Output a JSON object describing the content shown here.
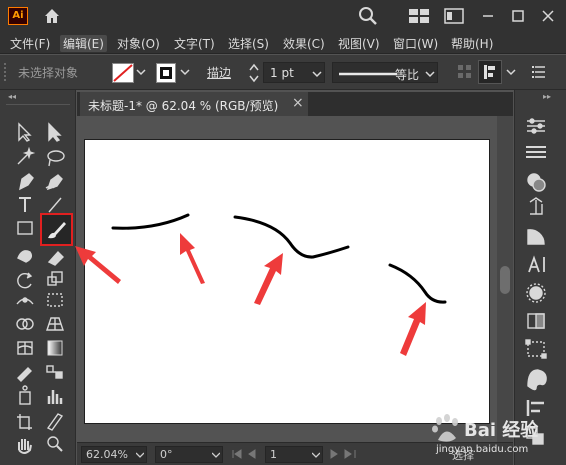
{
  "app": {
    "logo_text": "Ai"
  },
  "menus": [
    "文件(F)",
    "编辑(E)",
    "对象(O)",
    "文字(T)",
    "选择(S)",
    "效果(C)",
    "视图(V)",
    "窗口(W)",
    "帮助(H)"
  ],
  "control": {
    "selection_label": "未选择对象",
    "stroke_label": "描边",
    "stroke_value": "1 pt",
    "stroke_profile": "等比"
  },
  "document": {
    "tab_title": "未标题-1* @ 62.04 % (RGB/预览)",
    "close": "×"
  },
  "status": {
    "zoom": "62.04%",
    "rotation": "0°",
    "artboard_number": "1",
    "tool_label": "选择"
  },
  "colors": {
    "accent": "#ff7c00",
    "highlight_box": "#e02020",
    "arrow": "#ee3b3b"
  },
  "watermark": {
    "text": "Bai 经验",
    "url": "jingyan.baidu.com"
  }
}
